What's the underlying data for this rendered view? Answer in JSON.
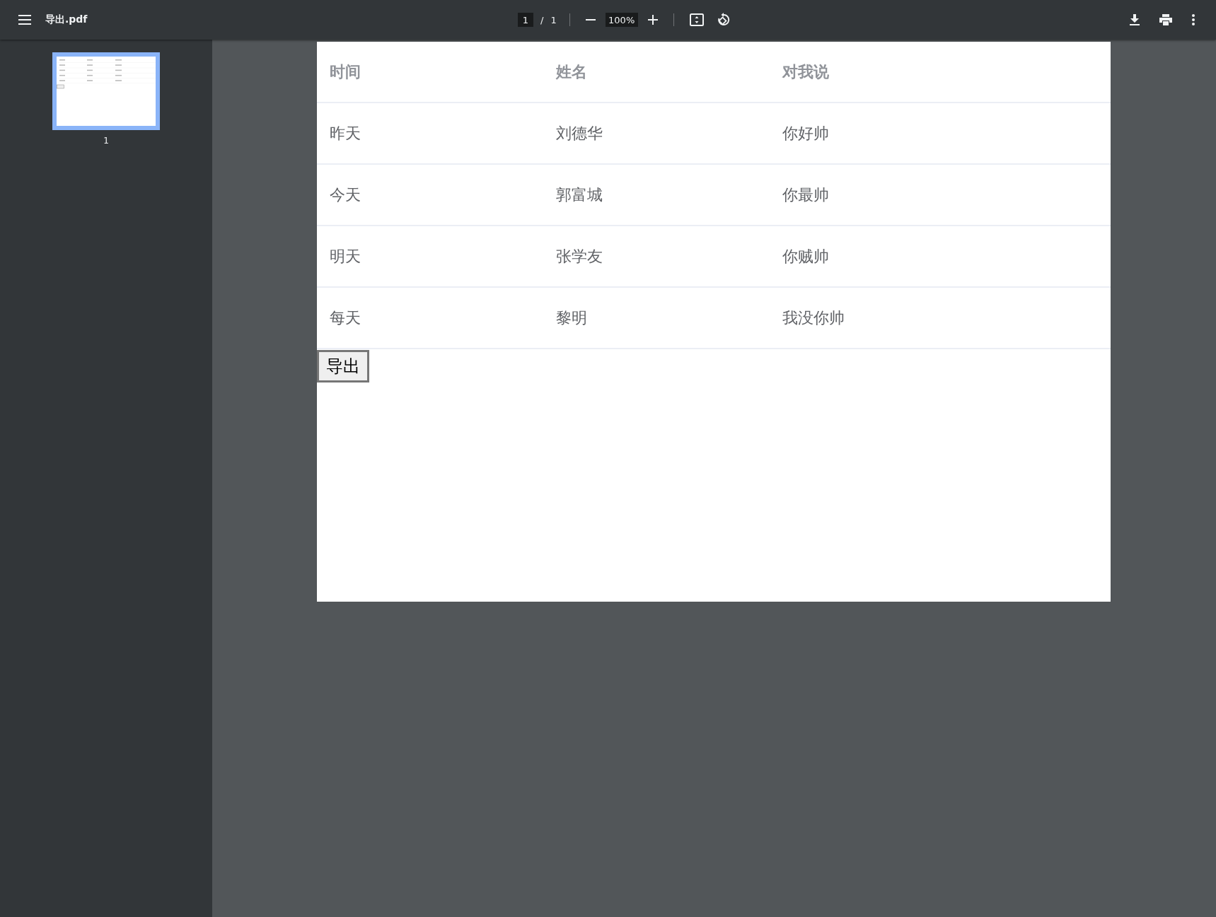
{
  "toolbar": {
    "title": "导出.pdf",
    "page_current": "1",
    "page_separator": "/",
    "page_total": "1",
    "zoom": "100%"
  },
  "thumbnails": [
    {
      "label": "1",
      "selected": true
    }
  ],
  "document": {
    "table": {
      "columns": [
        "时间",
        "姓名",
        "对我说"
      ],
      "rows": [
        [
          "昨天",
          "刘德华",
          "你好帅"
        ],
        [
          "今天",
          "郭富城",
          "你最帅"
        ],
        [
          "明天",
          "张学友",
          "你贼帅"
        ],
        [
          "每天",
          "黎明",
          "我没你帅"
        ]
      ]
    },
    "button": "导出"
  }
}
